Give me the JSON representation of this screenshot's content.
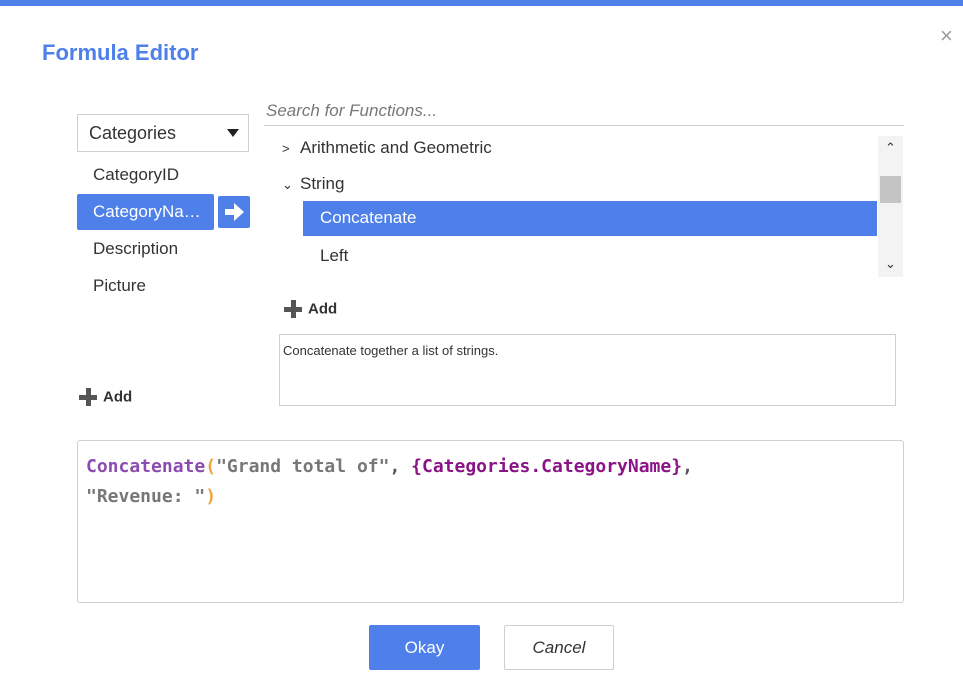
{
  "dialog": {
    "title": "Formula Editor",
    "close_icon": "×",
    "accent_color": "#4f80ea"
  },
  "fields_panel": {
    "table_select": {
      "value": "Categories"
    },
    "fields": [
      "CategoryID",
      "CategoryNa…",
      "Description",
      "Picture"
    ],
    "selected_index": 1,
    "insert_icon": "arrow-right-icon",
    "add_label": "Add"
  },
  "functions_panel": {
    "search_placeholder": "Search for Functions...",
    "categories": [
      {
        "chevron": ">",
        "label": "Arithmetic and Geometric",
        "expanded": false
      },
      {
        "chevron": "⌄",
        "label": "String",
        "expanded": true
      }
    ],
    "functions": [
      "Concatenate",
      "Left"
    ],
    "selected_function": "Concatenate",
    "scroll_up_icon": "⌃",
    "scroll_down_icon": "⌄",
    "add_label": "Add",
    "description": "Concatenate together a list of strings."
  },
  "editor": {
    "tokens_line1": {
      "func": "Concatenate",
      "open_paren": "(",
      "string1": "\"Grand total of\"",
      "comma1": ", ",
      "field": "{Categories.CategoryName}",
      "comma2": ","
    },
    "tokens_line2": {
      "string2": "\"Revenue: \"",
      "close_paren": ")"
    },
    "colors": {
      "function": "#8c4bb0",
      "paren": "#f0a340",
      "string": "#777777",
      "field": "#8a1487"
    }
  },
  "footer": {
    "ok_label": "Okay",
    "cancel_label": "Cancel"
  }
}
